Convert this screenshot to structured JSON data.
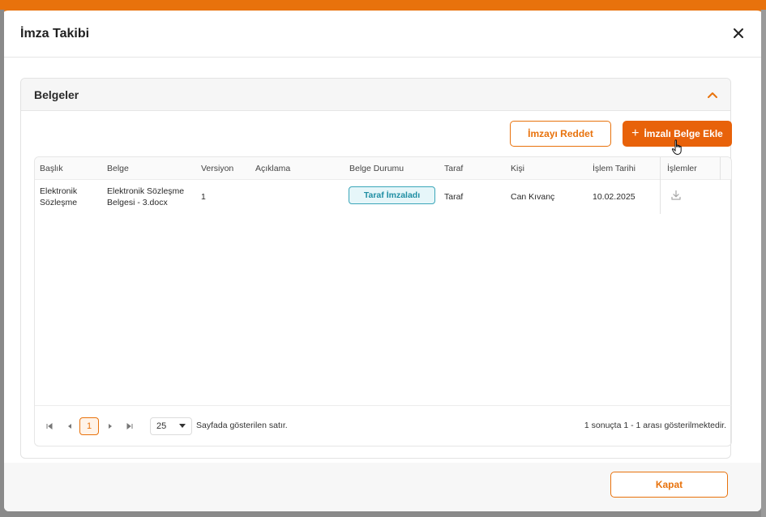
{
  "dialog": {
    "title": "İmza Takibi"
  },
  "panel": {
    "title": "Belgeler"
  },
  "actions": {
    "reject_label": "İmzayı Reddet",
    "add_label": "İmzalı Belge Ekle"
  },
  "table": {
    "headers": [
      "Başlık",
      "Belge",
      "Versiyon",
      "Açıklama",
      "Belge Durumu",
      "Taraf",
      "Kişi",
      "İşlem Tarihi",
      "İşlemler"
    ],
    "rows": [
      {
        "baslik_line1": "Elektronik",
        "baslik_line2": "Sözleşme",
        "belge_line1": "Elektronik Sözleşme",
        "belge_line2": "Belgesi - 3.docx",
        "versiyon": "1",
        "aciklama": "",
        "durum": "Taraf İmzaladı",
        "taraf": "Taraf",
        "kisi": "Can Kıvanç",
        "tarih": "10.02.2025"
      }
    ]
  },
  "pagination": {
    "current_page": "1",
    "page_size": "25",
    "rows_label": "Sayfada gösterilen satır.",
    "summary": "1 sonuçta 1 - 1 arası gösterilmektedir."
  },
  "footer": {
    "close_label": "Kapat"
  },
  "colors": {
    "accent": "#e8720c",
    "badge_border": "#3aa6b9",
    "badge_text": "#1f8ea3"
  }
}
